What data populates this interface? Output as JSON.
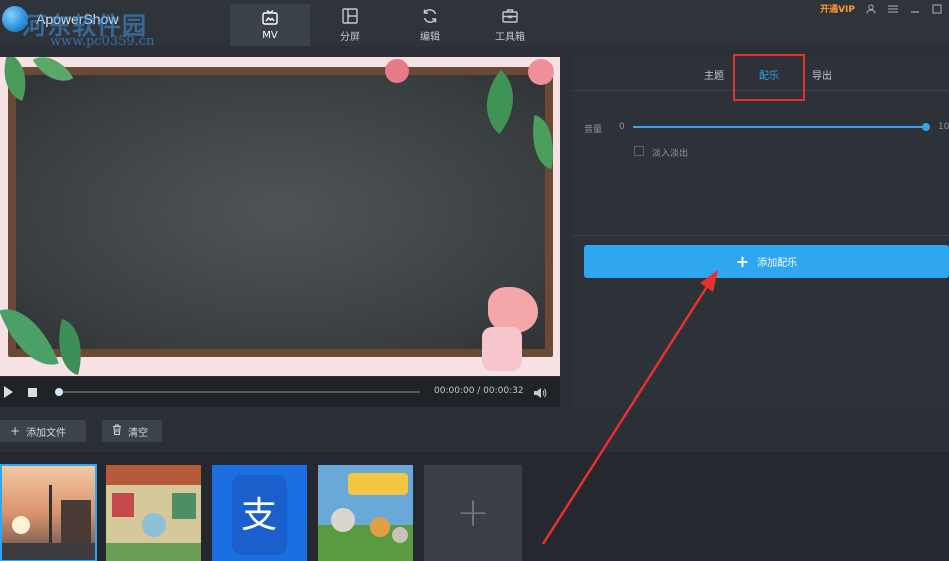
{
  "app": {
    "name": "ApowerShow"
  },
  "watermark": {
    "title": "河东软件园",
    "url": "www.pc0359.cn"
  },
  "nav": [
    {
      "label": "MV",
      "icon": "tv-icon"
    },
    {
      "label": "分屏",
      "icon": "split-screen-icon"
    },
    {
      "label": "编辑",
      "icon": "refresh-icon"
    },
    {
      "label": "工具箱",
      "icon": "toolbox-icon"
    }
  ],
  "topright": {
    "vip": "开通VIP"
  },
  "player": {
    "time": "00:00:00 / 00:00:32",
    "progress": 0.0
  },
  "panel": {
    "tabs": [
      "主题",
      "配乐",
      "导出"
    ],
    "active_tab": "配乐",
    "volume_label": "音量",
    "volume_min": "0",
    "volume_max": "10",
    "volume_value": 10,
    "fade_label": "淡入淡出",
    "add_music": "添加配乐"
  },
  "toolbar": {
    "add_file": "添加文件",
    "clear": "清空"
  },
  "colors": {
    "accent": "#2ea7f0",
    "annotation": "#e8302d",
    "vip": "#ff9a2e"
  }
}
